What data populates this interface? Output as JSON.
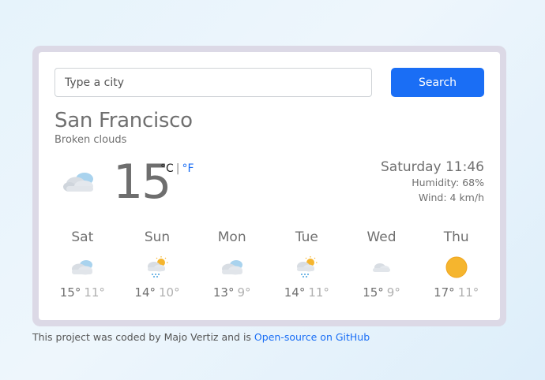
{
  "search": {
    "placeholder": "Type a city",
    "button_label": "Search"
  },
  "current": {
    "city": "San Francisco",
    "description": "Broken clouds",
    "temperature": "15",
    "unit_celsius": "°C",
    "unit_separator": "|",
    "unit_fahrenheit": "°F",
    "datetime": "Saturday 11:46",
    "humidity": "Humidity: 68%",
    "wind": "Wind: 4 km/h",
    "icon": "broken-clouds-icon"
  },
  "forecast": [
    {
      "day": "Sat",
      "max": "15°",
      "min": "11°",
      "icon": "broken-clouds-icon"
    },
    {
      "day": "Sun",
      "max": "14°",
      "min": "10°",
      "icon": "rain-sun-icon"
    },
    {
      "day": "Mon",
      "max": "13°",
      "min": "9°",
      "icon": "broken-clouds-icon"
    },
    {
      "day": "Tue",
      "max": "14°",
      "min": "11°",
      "icon": "rain-sun-icon"
    },
    {
      "day": "Wed",
      "max": "15°",
      "min": "9°",
      "icon": "few-clouds-icon"
    },
    {
      "day": "Thu",
      "max": "17°",
      "min": "11°",
      "icon": "clear-sun-icon"
    }
  ],
  "footer": {
    "text": "This project was coded by Majo Vertiz and is",
    "link_text": "Open-source on GitHub"
  },
  "colors": {
    "accent": "#1a6ef5",
    "text": "#707070",
    "muted": "#b0b0b0"
  }
}
